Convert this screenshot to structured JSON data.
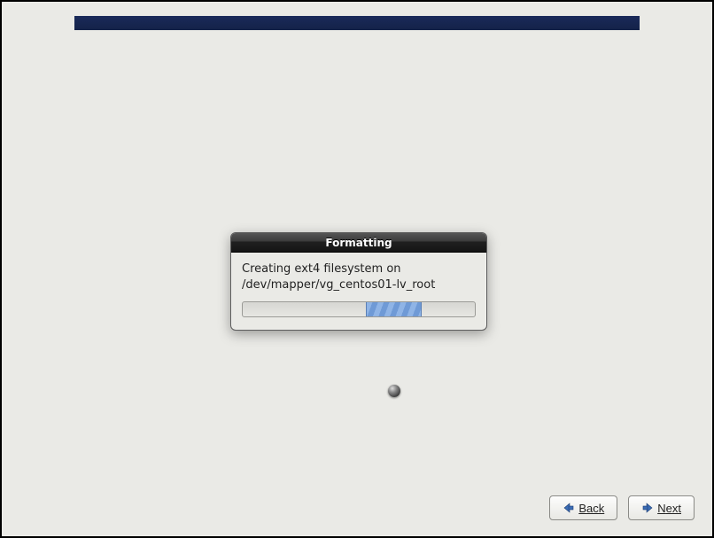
{
  "dialog": {
    "title": "Formatting",
    "message": "Creating ext4 filesystem on /dev/mapper/vg_centos01-lv_root",
    "progress_left_pct": 53,
    "progress_width_pct": 24
  },
  "footer": {
    "back_label": "Back",
    "next_label": "Next"
  }
}
